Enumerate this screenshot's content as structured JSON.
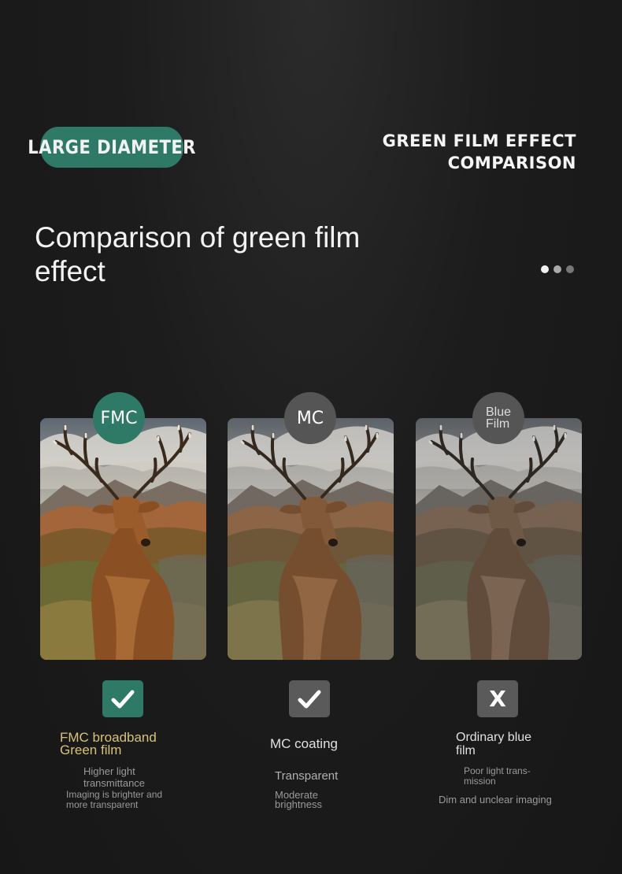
{
  "header": {
    "badge_label": "LARGE DIAMETER",
    "subtitle_line1": "GREEN FILM EFFECT",
    "subtitle_line2": "COMPARISON"
  },
  "title": "Comparison of green film effect",
  "pagination": {
    "count": 3,
    "active": 0
  },
  "colors": {
    "accent_green": "#2f7a66",
    "badge_gray": "#555555",
    "background": "#1c1c1c",
    "gold_text": "#d6c27a"
  },
  "columns": [
    {
      "badge": "FMC",
      "badge_line1": "",
      "badge_line2": "",
      "mark": "check",
      "heading_line1": "FMC broadband",
      "heading_line2": "Green film",
      "desc1_line1": "Higher light",
      "desc1_line2": "transmittance",
      "desc2_line1": "Imaging is brighter and",
      "desc2_line2": "more transparent"
    },
    {
      "badge": "MC",
      "mark": "check",
      "heading": "MC coating",
      "desc1": "Transparent",
      "desc2_line1": "Moderate",
      "desc2_line2": "brightness"
    },
    {
      "badge_line1": "Blue",
      "badge_line2": "Film",
      "mark": "x",
      "mark_label": "X",
      "heading_line1": "Ordinary blue",
      "heading_line2": "film",
      "desc1_line1": "Poor light trans-",
      "desc1_line2": "mission",
      "desc2": "Dim and unclear imaging"
    }
  ]
}
